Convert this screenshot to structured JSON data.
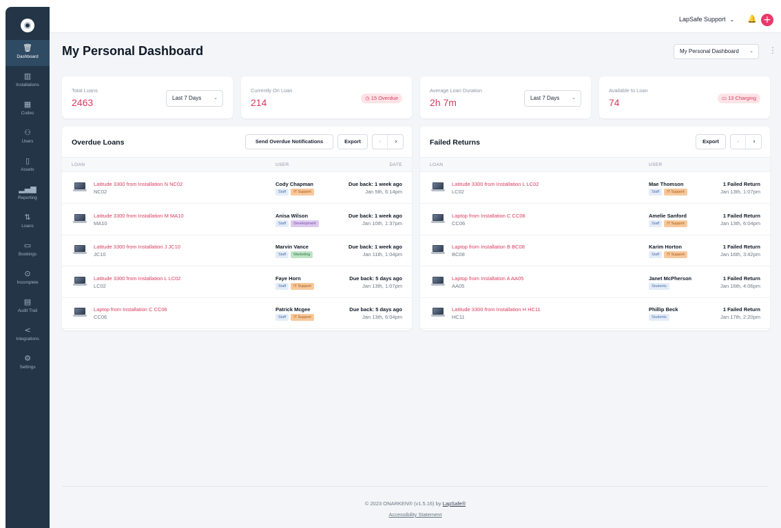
{
  "sidebar": {
    "items": [
      {
        "label": "Dashboard",
        "icon": "🗑",
        "active": true
      },
      {
        "label": "Installations",
        "icon": "▥"
      },
      {
        "label": "Codes",
        "icon": "▦"
      },
      {
        "label": "Users",
        "icon": "⚇"
      },
      {
        "label": "Assets",
        "icon": "▯"
      },
      {
        "label": "Reporting",
        "icon": "▂▄▆"
      },
      {
        "label": "Loans",
        "icon": "⇅"
      },
      {
        "label": "Bookings",
        "icon": "▭"
      },
      {
        "label": "Incomplete",
        "icon": "⊙"
      },
      {
        "label": "Audit Trail",
        "icon": "▤"
      },
      {
        "label": "Integrations",
        "icon": "<"
      },
      {
        "label": "Settings",
        "icon": "⚙"
      }
    ]
  },
  "topbar": {
    "user_menu": "LapSafe Support",
    "chevron": "⌄",
    "bell": "🔔",
    "plus": "+"
  },
  "page": {
    "title": "My Personal Dashboard",
    "dashboard_select": "My Personal Dashboard",
    "kebab": "⋮"
  },
  "stats": [
    {
      "label": "Total Loans",
      "value": "2463",
      "select": "Last 7 Days"
    },
    {
      "label": "Currently On Loan",
      "value": "214",
      "badge": "◷ 15 Overdue"
    },
    {
      "label": "Average Loan Duration",
      "value": "2h 7m",
      "select": "Last 7 Days"
    },
    {
      "label": "Available to Loan",
      "value": "74",
      "badge": "▭ 13 Charging"
    }
  ],
  "overdue": {
    "title": "Overdue Loans",
    "notify_label": "Send Overdue Notifications",
    "export_label": "Export",
    "prev": "‹",
    "next": "›",
    "columns": {
      "loan": "LOAN",
      "user": "USER",
      "date": "DATE"
    },
    "rows": [
      {
        "title": "Latitude 3300 from Installation N NC02",
        "code": "NC02",
        "user": "Cody Chapman",
        "tags": [
          [
            "Staff",
            "staff"
          ],
          [
            "IT Support",
            "it"
          ]
        ],
        "due": "Due back: 1 week ago",
        "date": "Jan 5th, 6:14pm"
      },
      {
        "title": "Latitude 3300 from Installation M MA10",
        "code": "MA10",
        "user": "Anisa Wilson",
        "tags": [
          [
            "Staff",
            "staff"
          ],
          [
            "Development",
            "dev"
          ]
        ],
        "due": "Due back: 1 week ago",
        "date": "Jan 10th, 1:37pm"
      },
      {
        "title": "Latitude 3300 from Installation J JC10",
        "code": "JC10",
        "user": "Marvin Vance",
        "tags": [
          [
            "Staff",
            "staff"
          ],
          [
            "Marketing",
            "mkt"
          ]
        ],
        "due": "Due back: 1 week ago",
        "date": "Jan 11th, 1:04pm"
      },
      {
        "title": "Latitude 3300 from Installation L LC02",
        "code": "LC02",
        "user": "Faye Horn",
        "tags": [
          [
            "Staff",
            "staff"
          ],
          [
            "IT Support",
            "it"
          ]
        ],
        "due": "Due back: 5 days ago",
        "date": "Jan 13th, 1:07pm"
      },
      {
        "title": "Laptop from Installation C CC06",
        "code": "CC06",
        "user": "Patrick Mcgee",
        "tags": [
          [
            "Staff",
            "staff"
          ],
          [
            "IT Support",
            "it"
          ]
        ],
        "due": "Due back: 5 days ago",
        "date": "Jan 13th, 6:04pm"
      }
    ]
  },
  "failed": {
    "title": "Failed Returns",
    "export_label": "Export",
    "prev": "‹",
    "next": "›",
    "columns": {
      "loan": "LOAN",
      "user": "USER"
    },
    "rows": [
      {
        "title": "Latitude 3300 from Installation L LC02",
        "code": "LC02",
        "user": "Mae Thomson",
        "tags": [
          [
            "Staff",
            "staff"
          ],
          [
            "IT Support",
            "it"
          ]
        ],
        "due": "1 Failed Return",
        "date": "Jan 13th, 1:07pm"
      },
      {
        "title": "Laptop from Installation C CC06",
        "code": "CC06",
        "user": "Amelie Sanford",
        "tags": [
          [
            "Staff",
            "staff"
          ],
          [
            "IT Support",
            "it"
          ]
        ],
        "due": "1 Failed Return",
        "date": "Jan 13th, 6:04pm"
      },
      {
        "title": "Laptop from Installation B BC08",
        "code": "BC08",
        "user": "Karim Horton",
        "tags": [
          [
            "Staff",
            "staff"
          ],
          [
            "IT Support",
            "it"
          ]
        ],
        "due": "1 Failed Return",
        "date": "Jan 16th, 3:42pm"
      },
      {
        "title": "Laptop from Installation A AA05",
        "code": "AA05",
        "user": "Janet McPherson",
        "tags": [
          [
            "Students",
            "students"
          ]
        ],
        "due": "1 Failed Return",
        "date": "Jan 16th, 4:06pm"
      },
      {
        "title": "Latitude 3300 from Installation H HC11",
        "code": "HC11",
        "user": "Phillip Beck",
        "tags": [
          [
            "Students",
            "students"
          ]
        ],
        "due": "1 Failed Return",
        "date": "Jan 17th, 2:20pm"
      }
    ]
  },
  "footer": {
    "copyright": "© 2023 ONARKEN® (v1.5.16) by",
    "link": "LapSafe®",
    "accessibility": "Accessibility Statement"
  },
  "colors": {
    "sidebar": "#233547",
    "accent": "#d93a5e",
    "plus_button": "#e8396a"
  }
}
